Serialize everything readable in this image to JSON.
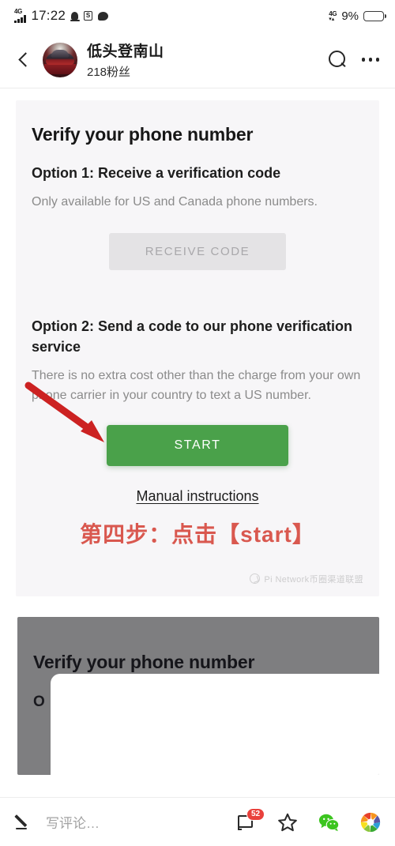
{
  "status_bar": {
    "network_left": "4G",
    "time": "17:22",
    "icons_left": [
      "bell-icon",
      "sogou-icon",
      "chat-blob-icon"
    ],
    "network_right": "4G",
    "battery_percent": "9%",
    "battery_level": 9
  },
  "header": {
    "back_icon": "back-arrow-icon",
    "avatar": "user-avatar-car",
    "user_name": "低头登南山",
    "followers": "218粉丝",
    "search_icon": "search-icon",
    "more_icon": "more-options-icon"
  },
  "post": {
    "screenshot_1": {
      "title": "Verify your phone number",
      "option1_heading": "Option 1: Receive a verification code",
      "option1_text": "Only available for US and Canada phone numbers.",
      "receive_code_button": "RECEIVE CODE",
      "option2_heading": "Option 2: Send a code to our phone verification service",
      "option2_text": "There is no extra cost other than the charge from your own phone carrier in your country to text a US number.",
      "start_button": "START",
      "manual_link": "Manual instructions",
      "annotation_text": "第四步：点击【start】",
      "annotation_color": "#d9584f",
      "arrow_color": "#cc2222",
      "start_button_color": "#4aa14a",
      "watermark": "Pi Network币圈渠道联盟"
    },
    "screenshot_2": {
      "title": "Verify your phone number",
      "partial_text": "O"
    }
  },
  "bottom_bar": {
    "pencil_icon": "pencil-icon",
    "comment_placeholder": "写评论…",
    "comment_icon": "comment-bubble-icon",
    "comment_count": "52",
    "favorite_icon": "star-icon",
    "wechat_icon": "wechat-share-icon",
    "more_share_icon": "aperture-share-icon"
  }
}
